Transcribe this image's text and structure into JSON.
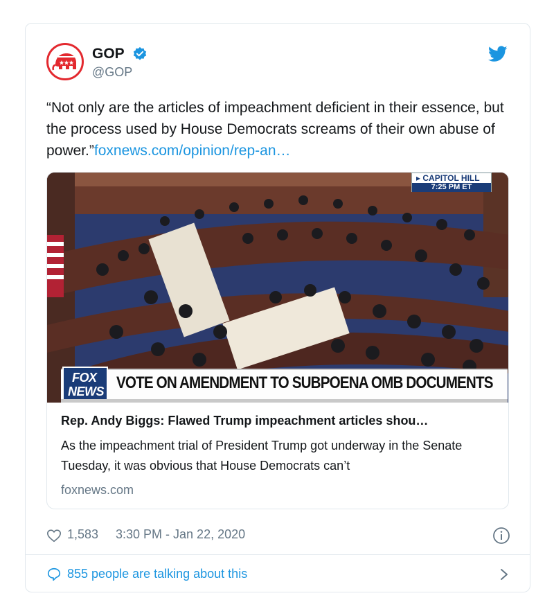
{
  "author": {
    "display_name": "GOP",
    "handle": "@GOP"
  },
  "tweet": {
    "text": "“Not only are the articles of impeachment deficient in their essence, but the process used by House Democrats screams of their own abuse of power.”",
    "link": "foxnews.com/opinion/rep-an…"
  },
  "media": {
    "chyron": "VOTE ON AMENDMENT TO SUBPOENA OMB DOCUMENTS",
    "network_line1": "FOX",
    "network_line2": "NEWS",
    "locator": "▸ CAPITOL HILL",
    "locator_time": "7:25 PM ET"
  },
  "card": {
    "title": "Rep. Andy Biggs: Flawed Trump impeachment articles shou…",
    "description": "As the impeachment trial of President Trump got underway in the Senate Tuesday, it was obvious that House Democrats can’t",
    "domain": "foxnews.com"
  },
  "meta": {
    "likes": "1,583",
    "timestamp": "3:30 PM - Jan 22, 2020"
  },
  "footer": {
    "talking": "855 people are talking about this"
  },
  "colors": {
    "twitter_blue": "#1b95e0",
    "gop_red": "#e3292f",
    "fox_blue": "#1a3c78"
  },
  "icons": [
    "gop-elephant-logo",
    "verified-badge-icon",
    "twitter-bird-icon",
    "heart-icon",
    "info-icon",
    "reply-bubble-icon",
    "chevron-right-icon"
  ]
}
